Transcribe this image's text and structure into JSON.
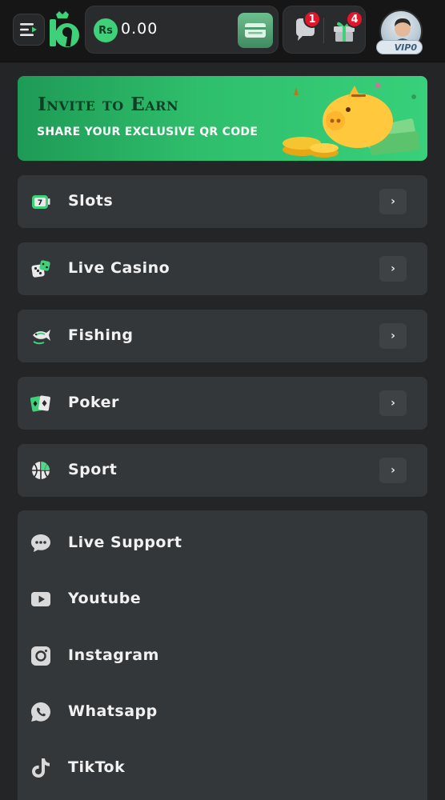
{
  "header": {
    "currency_symbol": "Rs",
    "balance": "0.00",
    "notifications_count": "1",
    "gifts_count": "4",
    "vip_label": "VIP0"
  },
  "banner": {
    "title": "Invite to Earn",
    "subtitle": "SHARE YOUR EXCLUSIVE QR CODE"
  },
  "categories": [
    {
      "label": "Slots",
      "icon": "slot-machine-icon"
    },
    {
      "label": "Live Casino",
      "icon": "dice-icon"
    },
    {
      "label": "Fishing",
      "icon": "fish-icon"
    },
    {
      "label": "Poker",
      "icon": "cards-icon"
    },
    {
      "label": "Sport",
      "icon": "basketball-icon"
    }
  ],
  "links": [
    {
      "label": "Live Support",
      "icon": "chat-icon"
    },
    {
      "label": "Youtube",
      "icon": "youtube-icon"
    },
    {
      "label": "Instagram",
      "icon": "instagram-icon"
    },
    {
      "label": "Whatsapp",
      "icon": "whatsapp-icon"
    },
    {
      "label": "TikTok",
      "icon": "tiktok-icon"
    }
  ],
  "colors": {
    "accent": "#3fd07a",
    "background": "#232526",
    "card": "#34373a",
    "badge": "#e3152a"
  }
}
